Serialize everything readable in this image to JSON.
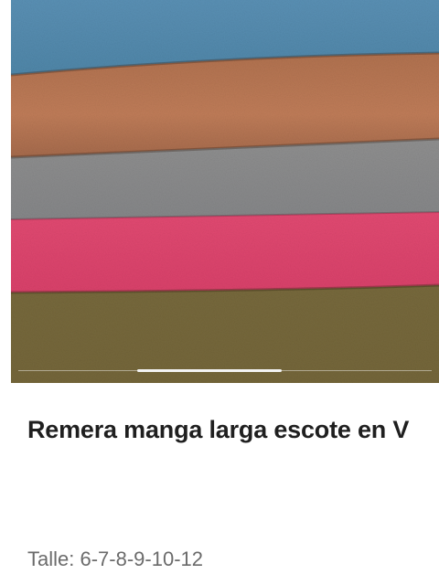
{
  "product": {
    "title": "Remera manga larga escote en V",
    "size_label": "Talle: 6-7-8-9-10-12"
  },
  "gallery": {
    "image_description_icon": "fabric-swatches-photo",
    "swatch_colors": [
      "#5b8fb0",
      "#b67552",
      "#8c8c8c",
      "#e0476f",
      "#7d6e3f"
    ],
    "active_slide_indicator": "carousel-position"
  }
}
